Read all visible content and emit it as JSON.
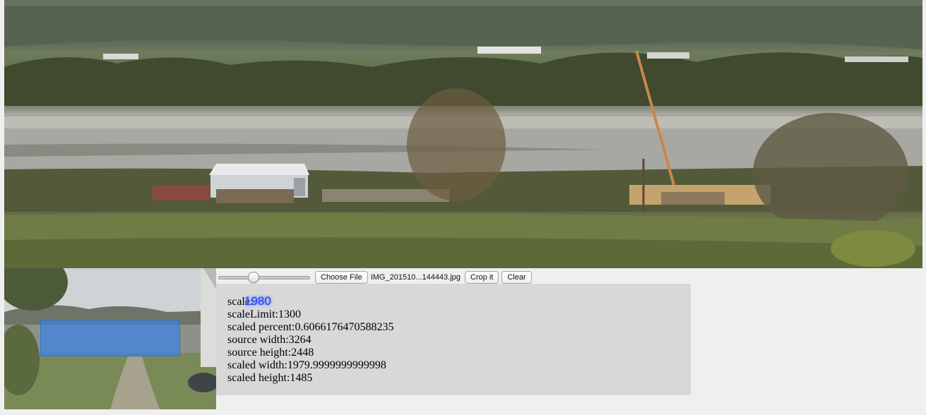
{
  "images": {
    "main_photo": "cropped-landscape-photo",
    "thumbnail": "source-thumbnail-photo"
  },
  "controls": {
    "zoom_slider": {
      "value_fraction": 0.37
    },
    "choose_file_label": "Choose File",
    "file_name": "IMG_201510...144443.jpg",
    "crop_label": "Crop it",
    "clear_label": "Clear"
  },
  "info": {
    "scale_label": "scale:",
    "scale_value": "1980",
    "scale_limit": "scaleLimit:1300",
    "scaled_percent": "scaled percent:0.6066176470588235",
    "source_width": "source width:3264",
    "source_height": "source height:2448",
    "scaled_width": "scaled width:1979.9999999999998",
    "scaled_height": "scaled height:1485"
  },
  "colors": {
    "crop_box": "#3c82e6",
    "info_panel_bg": "#d8d8d8",
    "scale_value_text": "#2142ff",
    "page_bg": "#efefef"
  }
}
